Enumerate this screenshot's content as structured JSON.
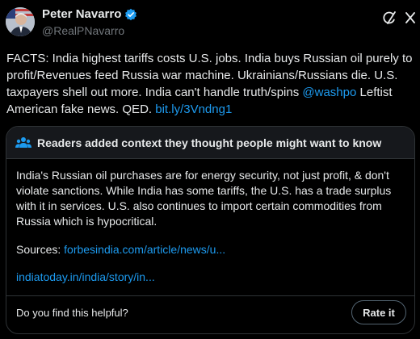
{
  "author": {
    "display_name": "Peter Navarro",
    "handle": "@RealPNavarro"
  },
  "post": {
    "text_main": "FACTS: India highest tariffs costs U.S. jobs.  India buys Russian oil purely to profit/Revenues feed Russia war machine.  Ukrainians/Russians die. U.S. taxpayers shell out more.  India can't handle truth/spins ",
    "mention": "@washpo",
    "text_after_mention": " Leftist American fake news.  QED. ",
    "link": "bit.ly/3Vndng1"
  },
  "community_note": {
    "title": "Readers added context they thought people might want to know",
    "body": "India's Russian oil purchases are for energy security, not just profit, & don't violate sanctions. While India has some tariffs, the U.S. has a trade surplus with it in services. U.S. also continues to import certain commodities from Russia which is hypocritical.",
    "sources_label": "Sources: ",
    "source_1": "forbesindia.com/article/news/u...",
    "source_2": "indiatoday.in/india/story/in...",
    "helpful_prompt": "Do you find this helpful?",
    "rate_button": "Rate it"
  },
  "colors": {
    "background": "#000000",
    "text": "#e7e9ea",
    "secondary_text": "#71767b",
    "link": "#1d9bf0",
    "border": "#2f3336",
    "verified_badge": "#1d9bf0"
  },
  "icons": [
    "verified-badge-icon",
    "grok-icon",
    "close-icon",
    "people-icon"
  ]
}
